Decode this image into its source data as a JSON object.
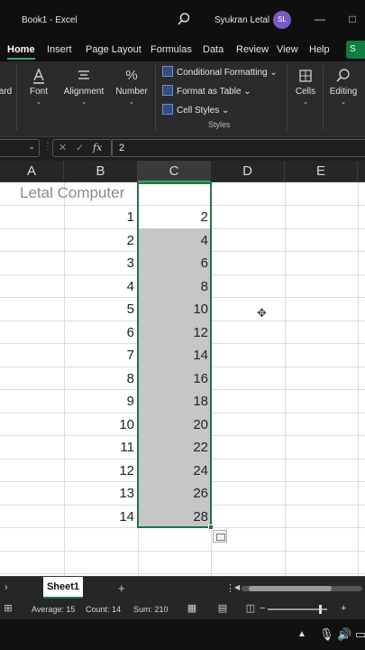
{
  "titlebar": {
    "title": "Book1  -  Excel",
    "search_icon": "search-icon",
    "user_name": "Syukran Letal",
    "avatar_initials": "SL",
    "minimize": "—",
    "maximize": "□"
  },
  "menu": {
    "tabs": [
      "Home",
      "Insert",
      "Page Layout",
      "Formulas",
      "Data",
      "Review",
      "View",
      "Help"
    ],
    "active": "Home",
    "share_label": "S"
  },
  "ribbon": {
    "clipboard_label": "ard",
    "font_label": "Font",
    "alignment_label": "Alignment",
    "number_label": "Number",
    "number_icon": "%",
    "styles": {
      "conditional": "Conditional Formatting",
      "format_table": "Format as Table",
      "cell_styles": "Cell Styles",
      "group_label": "Styles"
    },
    "cells_label": "Cells",
    "editing_label": "Editing"
  },
  "formula_bar": {
    "name_box": "",
    "cancel": "✕",
    "enter": "✓",
    "fx": "fx",
    "value": "2"
  },
  "columns": [
    "A",
    "B",
    "C",
    "D",
    "E"
  ],
  "sheet": {
    "title_cell": "Letal Computer",
    "col_b": [
      "1",
      "2",
      "3",
      "4",
      "5",
      "6",
      "7",
      "8",
      "9",
      "10",
      "11",
      "12",
      "13",
      "14"
    ],
    "col_c": [
      "2",
      "4",
      "6",
      "8",
      "10",
      "12",
      "14",
      "16",
      "18",
      "20",
      "22",
      "24",
      "26",
      "28"
    ]
  },
  "sheet_tabs": {
    "tab_name": "Sheet1",
    "add": "+",
    "prev": "›",
    "more": "⋮",
    "scroll_left": "◀"
  },
  "status": {
    "average": "Average: 15",
    "count": "Count: 14",
    "sum": "Sum: 210",
    "zoom_minus": "−",
    "zoom_plus": "+"
  },
  "taskbar": {
    "chevron": "▲",
    "mic": "🎙",
    "volume": "🔊",
    "battery": "▭"
  },
  "colors": {
    "accent": "#217346",
    "selection": "#c6c6c6",
    "avatar": "#7b59c4"
  }
}
